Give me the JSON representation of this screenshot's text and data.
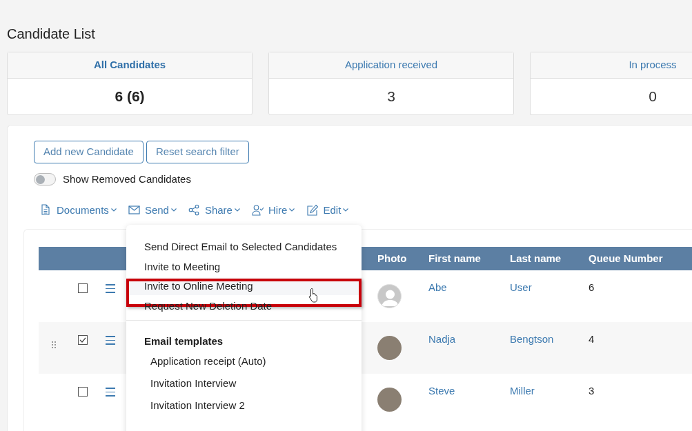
{
  "title": "Candidate List",
  "stat_cards": [
    {
      "label": "All Candidates",
      "value": "6 (6)",
      "selected": true
    },
    {
      "label": "Application received",
      "value": "3",
      "selected": false
    },
    {
      "label": "In process",
      "value": "0",
      "selected": false
    }
  ],
  "buttons": [
    "Add new Candidate",
    "Reset search filter"
  ],
  "toggle": {
    "label": "Show Removed Candidates",
    "on": false
  },
  "toolbar": [
    {
      "label": "Documents",
      "kind": "document"
    },
    {
      "label": "Send",
      "kind": "envelope"
    },
    {
      "label": "Share",
      "kind": "share"
    },
    {
      "label": "Hire",
      "kind": "user-check"
    },
    {
      "label": "Edit",
      "kind": "edit"
    }
  ],
  "send_menu": {
    "items": [
      {
        "label": "Send Direct Email to Selected Candidates",
        "highlighted": false
      },
      {
        "label": "Invite to Meeting",
        "highlighted": false
      },
      {
        "label": "Invite to Online Meeting",
        "highlighted": true
      },
      {
        "label": "Request New Deletion Date",
        "highlighted": false
      }
    ],
    "section_title": "Email templates",
    "templates": [
      "Application receipt (Auto)",
      "Invitation Interview",
      "Invitation Interview 2"
    ]
  },
  "table": {
    "columns": [
      "Photo",
      "First name",
      "Last name",
      "Queue Number"
    ],
    "rows": [
      {
        "checked": false,
        "hovered": false,
        "kind": "silhouette",
        "first_name": "Abe",
        "last_name": "User",
        "queue_number": "6"
      },
      {
        "checked": true,
        "hovered": true,
        "kind": "photo",
        "first_name": "Nadja",
        "last_name": "Bengtson",
        "queue_number": "4"
      },
      {
        "checked": false,
        "hovered": false,
        "kind": "photo",
        "first_name": "Steve",
        "last_name": "Miller",
        "queue_number": "3"
      }
    ]
  }
}
